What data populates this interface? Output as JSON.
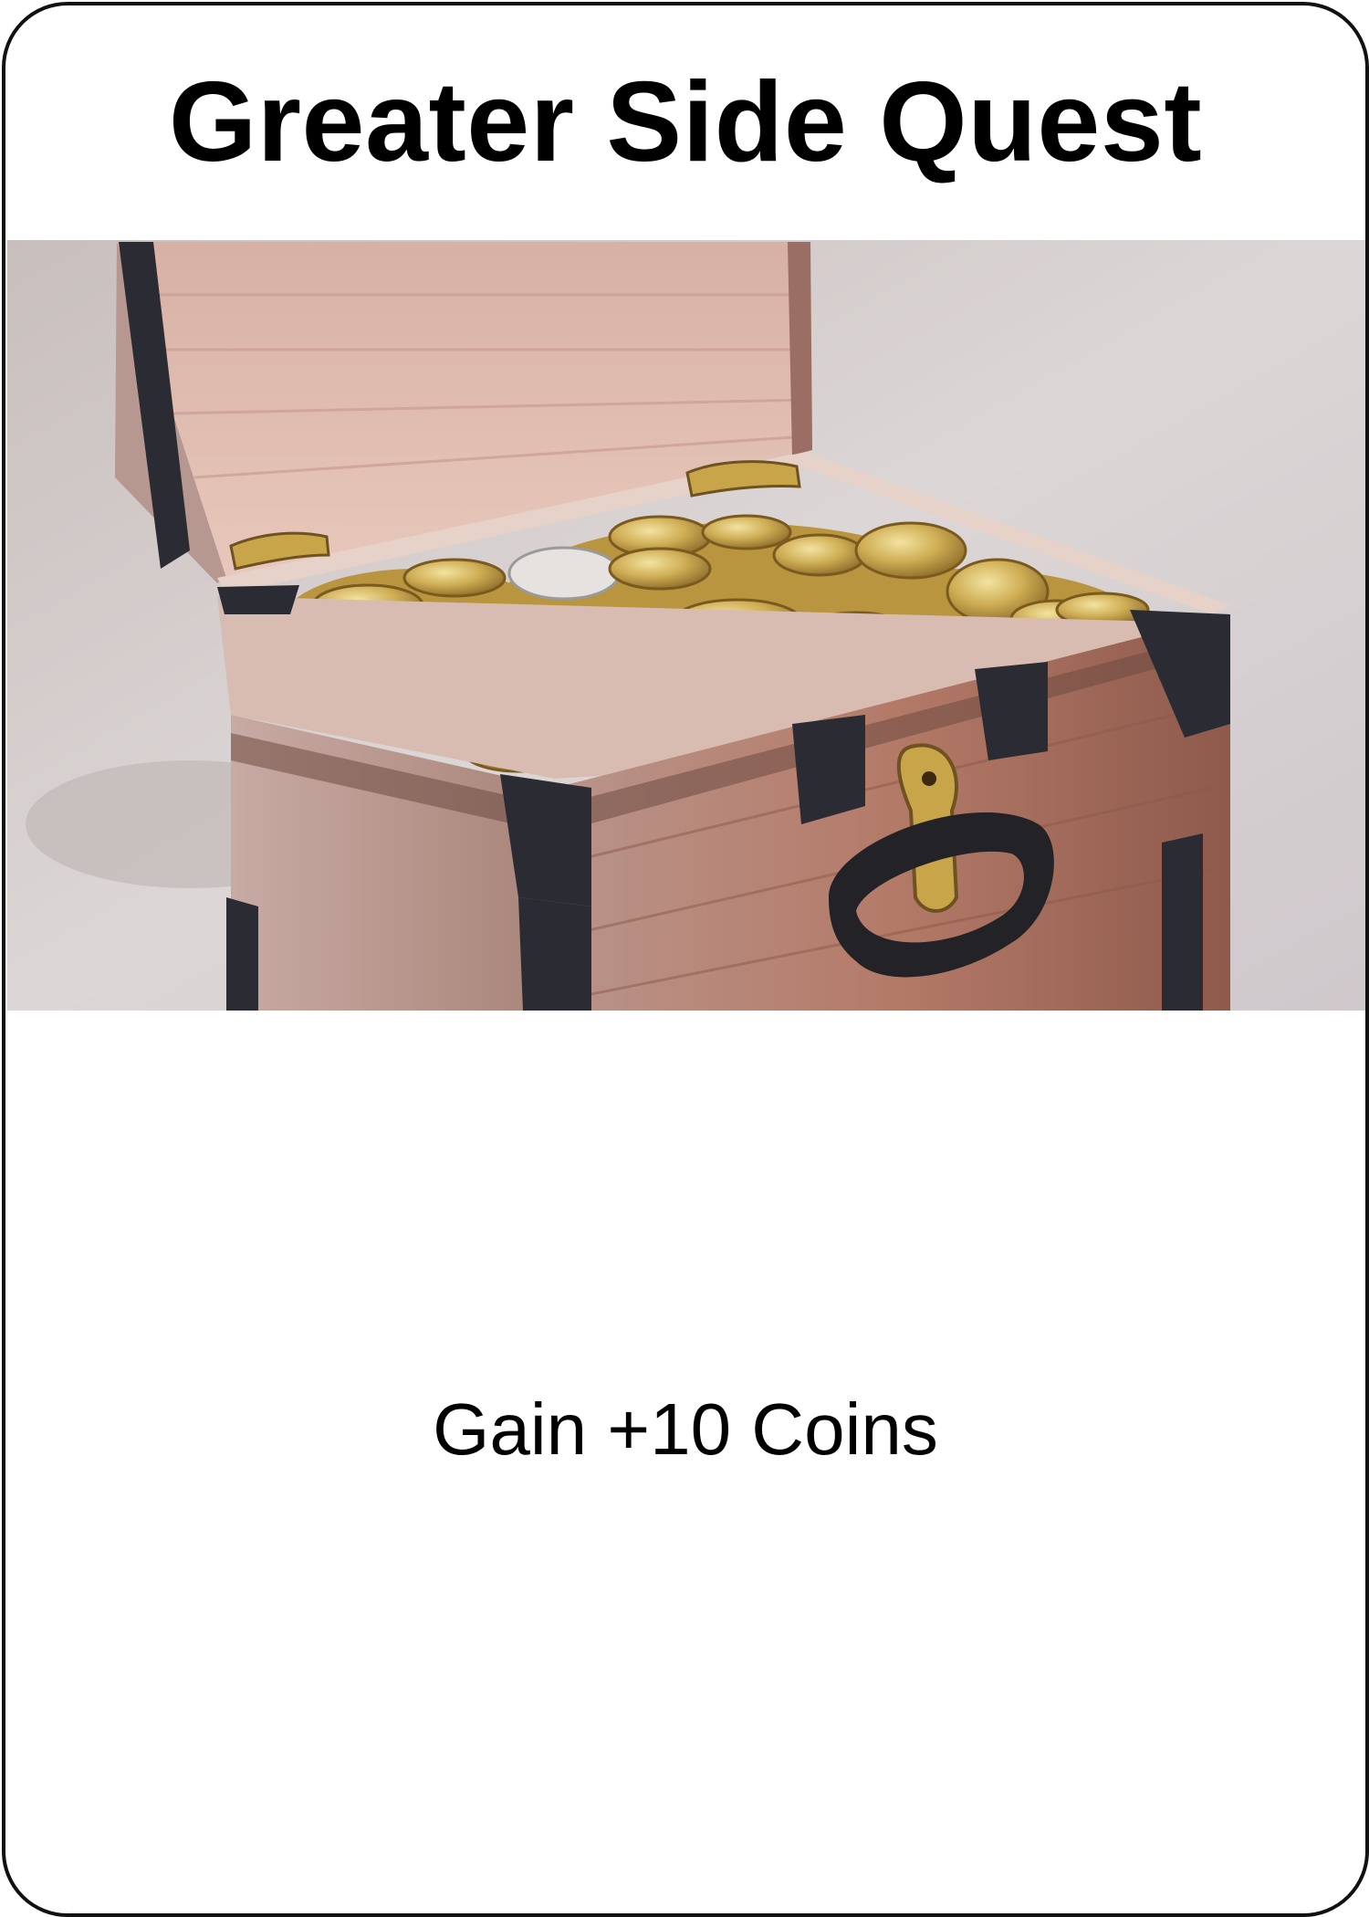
{
  "card": {
    "title": "Greater Side Quest",
    "effect_text": "Gain +10 Coins",
    "artwork": "treasure-chest-illustration"
  },
  "colors": {
    "border": "#111111",
    "background": "#ffffff",
    "text": "#000000",
    "wood": "#b07a6c",
    "iron": "#2a2a2e",
    "gold": "#c9a54a"
  }
}
